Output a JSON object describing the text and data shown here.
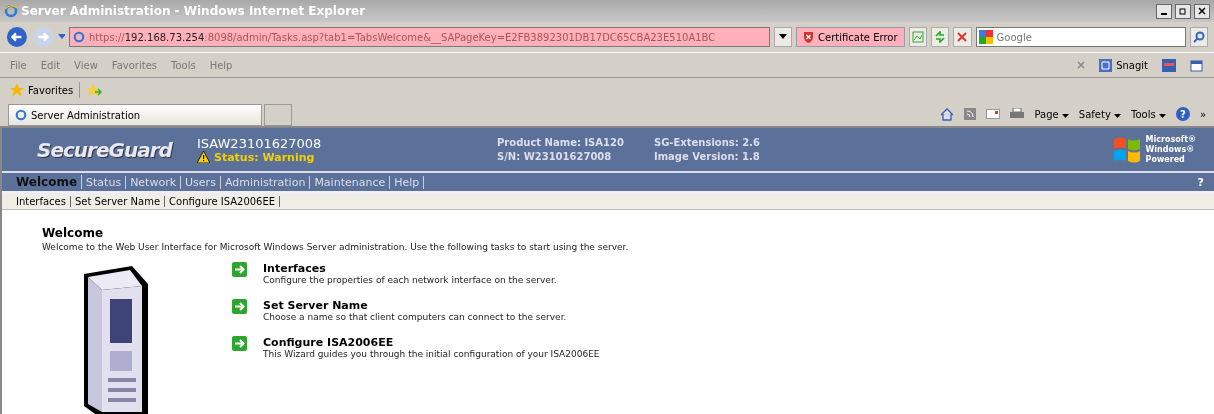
{
  "window": {
    "title": "Server Administration - Windows Internet Explorer"
  },
  "address_bar": {
    "url_prefix": "https://",
    "url_host": "192.168.73.254",
    "url_rest": ":8098/admin/Tasks.asp?tab1=TabsWelcome&__SAPageKey=E2FB3892301DB17DC65CBA23E510A1BC",
    "certificate": "Certificate Error"
  },
  "search": {
    "placeholder": "Google"
  },
  "menu": [
    "File",
    "Edit",
    "View",
    "Favorites",
    "Tools",
    "Help"
  ],
  "toolbar_right": {
    "snagit": "Snagit"
  },
  "favorites": {
    "label": "Favorites"
  },
  "browser_tabs": [
    {
      "label": "Server Administration",
      "selected": true
    }
  ],
  "command_bar": [
    "Page",
    "Safety",
    "Tools"
  ],
  "help_button": "?",
  "more": "»",
  "header": {
    "logo": "SecureGuard",
    "host": "ISAW23101627008",
    "status": "Status: Warning",
    "product_name": "Product Name: ISA120",
    "serial": "S/N: W23101627008",
    "extensions": "SG-Extensions: 2.6",
    "image_version": "Image Version: 1.8",
    "windows_logo": [
      "Microsoft®",
      "Windows®",
      "Powered"
    ]
  },
  "nav_tabs": [
    {
      "label": "Welcome",
      "selected": true
    },
    {
      "label": "Status",
      "selected": false
    },
    {
      "label": "Network",
      "selected": false
    },
    {
      "label": "Users",
      "selected": false
    },
    {
      "label": "Administration",
      "selected": false
    },
    {
      "label": "Maintenance",
      "selected": false
    },
    {
      "label": "Help",
      "selected": false
    }
  ],
  "help_mark": "?",
  "sub_nav": [
    "Interfaces",
    "Set Server Name",
    "Configure ISA2006EE"
  ],
  "content": {
    "heading": "Welcome",
    "intro": "Welcome to the Web User Interface for Microsoft Windows Server administration. Use the following tasks to start using the server.",
    "tasks": [
      {
        "title": "Interfaces",
        "description": "Configure the properties of each network interface on the server."
      },
      {
        "title": "Set Server Name",
        "description": "Choose a name so that client computers can connect to the server."
      },
      {
        "title": "Configure ISA2006EE",
        "description": "This Wizard guides you through the initial configuration of your ISA2006EE"
      }
    ]
  }
}
